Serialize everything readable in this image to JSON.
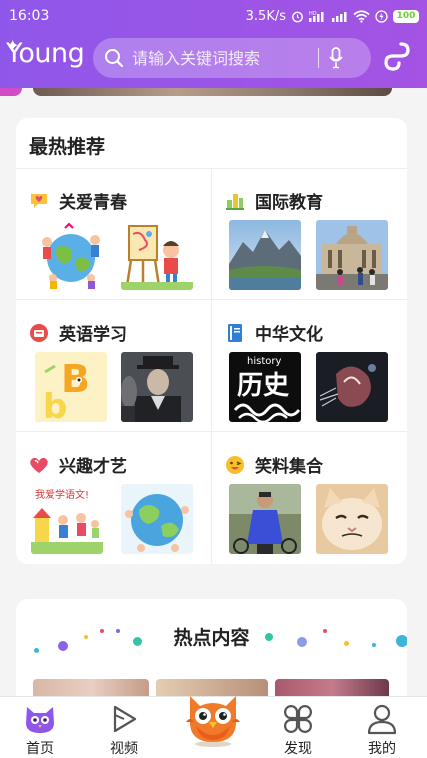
{
  "status_bar": {
    "time": "16:03",
    "net_speed": "3.5K/s",
    "battery": "100"
  },
  "app_bar": {
    "logo": "Young",
    "search_placeholder": "请输入关键词搜索"
  },
  "hot_recommend": {
    "title": "最热推荐",
    "categories": [
      {
        "name": "关爱青春",
        "icon": "heart-bubble-icon",
        "color": "#f7c43c"
      },
      {
        "name": "国际教育",
        "icon": "building-icon",
        "color": "#8bcf5e"
      },
      {
        "name": "英语学习",
        "icon": "english-icon",
        "color": "#e94b48"
      },
      {
        "name": "中华文化",
        "icon": "book-icon",
        "color": "#2f7fd6"
      },
      {
        "name": "兴趣才艺",
        "icon": "heart-icon",
        "color": "#e94b66"
      },
      {
        "name": "笑料集合",
        "icon": "laugh-emoji-icon",
        "color": "#f5c02a"
      }
    ],
    "thumb_texts": {
      "history": "history",
      "lishi": "历史",
      "chinese": "我爱学语文!"
    }
  },
  "hot_content": {
    "title": "热点内容"
  },
  "bottom_nav": {
    "items": [
      {
        "label": "首页",
        "icon": "owl-home-icon"
      },
      {
        "label": "视频",
        "icon": "play-icon"
      },
      {
        "label": "",
        "icon": "owl-mascot-icon"
      },
      {
        "label": "发现",
        "icon": "discover-icon"
      },
      {
        "label": "我的",
        "icon": "user-icon"
      }
    ]
  },
  "colors": {
    "brand_purple": "#9b55e6",
    "card_bg": "#ffffff",
    "page_bg": "#f4f4f4"
  }
}
